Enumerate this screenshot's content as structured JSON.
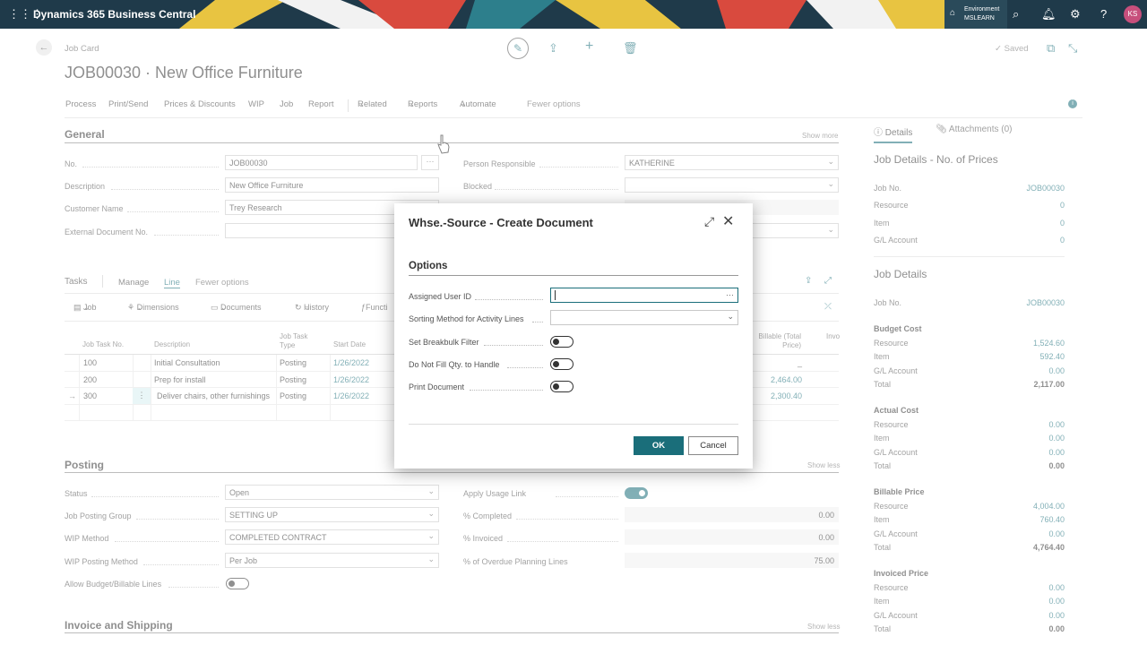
{
  "topbar": {
    "app_name": "Dynamics 365 Business Central",
    "env_label": "Environment",
    "env_name": "MSLEARN",
    "user_initials": "KS",
    "icons": [
      "waffle-icon",
      "search-icon",
      "bell-icon",
      "gear-icon",
      "help-icon"
    ]
  },
  "page": {
    "breadcrumb": "Job Card",
    "title": "JOB00030 · New Office Furniture",
    "saved": "Saved",
    "menu": [
      "Process",
      "Print/Send",
      "Prices & Discounts",
      "WIP",
      "Job",
      "Report",
      "Related",
      "Reports",
      "Automate",
      "Fewer options"
    ]
  },
  "general": {
    "title": "General",
    "show_more": "Show more",
    "fields": {
      "no_label": "No.",
      "no_value": "JOB00030",
      "desc_label": "Description",
      "desc_value": "New Office Furniture",
      "cust_label": "Customer Name",
      "cust_value": "Trey Research",
      "extdoc_label": "External Document No.",
      "extdoc_value": "",
      "person_label": "Person Responsible",
      "person_value": "KATHERINE",
      "blocked_label": "Blocked",
      "blocked_value": ""
    }
  },
  "tasks": {
    "title": "Tasks",
    "tabs": [
      "Manage",
      "Line",
      "Fewer options"
    ],
    "toolbar": [
      "Job",
      "Dimensions",
      "Documents",
      "History",
      "Functi"
    ],
    "headers": [
      "Job Task No.",
      "Description",
      "Job Task Type",
      "Start Date",
      "Billable (Total Price)",
      "Invo"
    ],
    "rows": [
      {
        "no": "100",
        "desc": "Initial Consultation",
        "type": "Posting",
        "date": "1/26/2022",
        "billable": "_"
      },
      {
        "no": "200",
        "desc": "Prep for install",
        "type": "Posting",
        "date": "1/26/2022",
        "billable": "2,464.00"
      },
      {
        "no": "300",
        "desc": "Deliver chairs, other furnishings",
        "type": "Posting",
        "date": "1/26/2022",
        "billable": "2,300.40"
      }
    ]
  },
  "posting": {
    "title": "Posting",
    "show_less": "Show less",
    "status_label": "Status",
    "status_value": "Open",
    "jpg_label": "Job Posting Group",
    "jpg_value": "SETTING UP",
    "wip_label": "WIP Method",
    "wip_value": "COMPLETED CONTRACT",
    "wipp_label": "WIP Posting Method",
    "wipp_value": "Per Job",
    "allow_label": "Allow Budget/Billable Lines",
    "usage_label": "Apply Usage Link",
    "completed_label": "% Completed",
    "completed_value": "0.00",
    "invoiced_label": "% Invoiced",
    "invoiced_value": "0.00",
    "overdue_label": "% of Overdue Planning Lines",
    "overdue_value": "75.00"
  },
  "invoice": {
    "title": "Invoice and Shipping",
    "show_less": "Show less"
  },
  "factbox": {
    "tab_details": "Details",
    "tab_attachments": "Attachments (0)",
    "prices_title": "Job Details - No. of Prices",
    "prices": [
      {
        "label": "Job No.",
        "value": "JOB00030"
      },
      {
        "label": "Resource",
        "value": "0"
      },
      {
        "label": "Item",
        "value": "0"
      },
      {
        "label": "G/L Account",
        "value": "0"
      }
    ],
    "details_title": "Job Details",
    "job_no_label": "Job No.",
    "job_no_value": "JOB00030",
    "budget": {
      "title": "Budget Cost",
      "rows": [
        [
          "Resource",
          "1,524.60"
        ],
        [
          "Item",
          "592.40"
        ],
        [
          "G/L Account",
          "0.00"
        ],
        [
          "Total",
          "2,117.00"
        ]
      ]
    },
    "actual": {
      "title": "Actual Cost",
      "rows": [
        [
          "Resource",
          "0.00"
        ],
        [
          "Item",
          "0.00"
        ],
        [
          "G/L Account",
          "0.00"
        ],
        [
          "Total",
          "0.00"
        ]
      ]
    },
    "billable": {
      "title": "Billable Price",
      "rows": [
        [
          "Resource",
          "4,004.00"
        ],
        [
          "Item",
          "760.40"
        ],
        [
          "G/L Account",
          "0.00"
        ],
        [
          "Total",
          "4,764.40"
        ]
      ]
    },
    "invoiced": {
      "title": "Invoiced Price",
      "rows": [
        [
          "Resource",
          "0.00"
        ],
        [
          "Item",
          "0.00"
        ],
        [
          "G/L Account",
          "0.00"
        ],
        [
          "Total",
          "0.00"
        ]
      ]
    }
  },
  "dialog": {
    "title": "Whse.-Source - Create Document",
    "section": "Options",
    "assigned_label": "Assigned User ID",
    "assigned_value": "",
    "sorting_label": "Sorting Method for Activity Lines",
    "sorting_value": "",
    "breakbulk_label": "Set Breakbulk Filter",
    "donotfill_label": "Do Not Fill Qty. to Handle",
    "print_label": "Print Document",
    "ok": "OK",
    "cancel": "Cancel"
  },
  "colors": {
    "accent": "#1a6e7a",
    "topbar": "#1f3a4a"
  }
}
